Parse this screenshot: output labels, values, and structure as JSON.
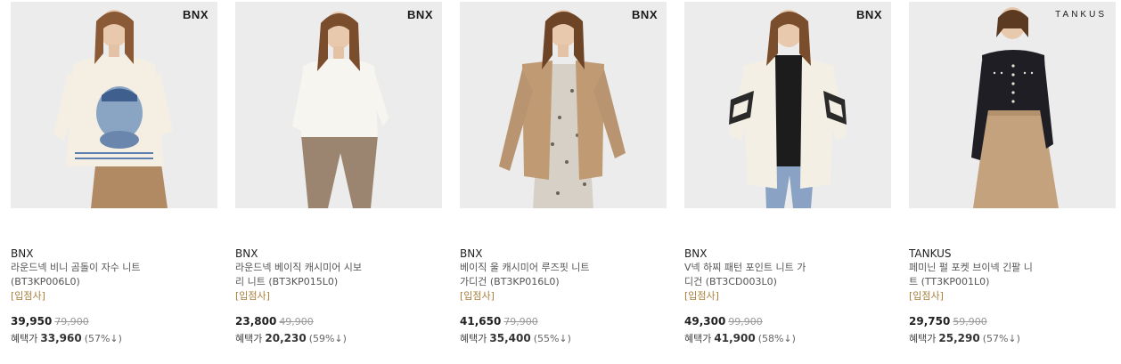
{
  "products": [
    {
      "logo": "BNX",
      "brand": "BNX",
      "name_line1": "라운드넥 비니 곰돌이 자수 니트",
      "name_line2": "(BT3KP006L0)",
      "store_tag": "[입점사]",
      "price": "39,950",
      "original_price": "79,900",
      "benefit_label": "혜택가",
      "benefit_price": "33,960",
      "discount": "(57%↓)"
    },
    {
      "logo": "BNX",
      "brand": "BNX",
      "name_line1": "라운드넥 베이직 캐시미어 시보",
      "name_line2": "리 니트 (BT3KP015L0)",
      "store_tag": "[입점사]",
      "price": "23,800",
      "original_price": "49,900",
      "benefit_label": "혜택가",
      "benefit_price": "20,230",
      "discount": "(59%↓)"
    },
    {
      "logo": "BNX",
      "brand": "BNX",
      "name_line1": "베이직 울 캐시미어 루즈핏 니트",
      "name_line2": "가디건 (BT3KP016L0)",
      "store_tag": "[입점사]",
      "price": "41,650",
      "original_price": "79,900",
      "benefit_label": "혜택가",
      "benefit_price": "35,400",
      "discount": "(55%↓)"
    },
    {
      "logo": "BNX",
      "brand": "BNX",
      "name_line1": "V넥 하찌 패턴 포인트 니트 가",
      "name_line2": "디건 (BT3CD003L0)",
      "store_tag": "[입점사]",
      "price": "49,300",
      "original_price": "99,900",
      "benefit_label": "혜택가",
      "benefit_price": "41,900",
      "discount": "(58%↓)"
    },
    {
      "logo": "TANKUS",
      "brand": "TANKUS",
      "name_line1": "페미닌 펄 포켓 브이넥 긴팔 니",
      "name_line2": "트 (TT3KP001L0)",
      "store_tag": "[입점사]",
      "price": "29,750",
      "original_price": "59,900",
      "benefit_label": "혜택가",
      "benefit_price": "25,290",
      "discount": "(57%↓)"
    }
  ]
}
